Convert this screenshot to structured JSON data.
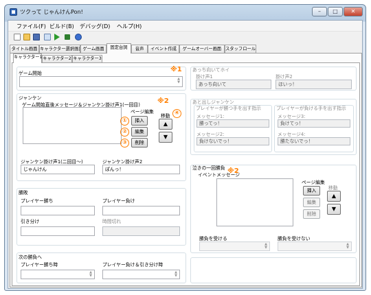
{
  "window": {
    "title": "ツクって じゃんけんPon!",
    "btn_min": "–",
    "btn_max": "□",
    "btn_close": "✕"
  },
  "menu": [
    "ファイル(F)",
    "ビルド(B)",
    "デバッグ(D)",
    "ヘルプ(H)"
  ],
  "toolbar_icons": [
    "new-document-icon",
    "open-folder-icon",
    "save-disk-icon",
    "copy-pages-icon",
    "play-icon",
    "stop-icon",
    "help-icon"
  ],
  "top_tabs": [
    "タイトル画面",
    "キャラクター選択画面",
    "ゲーム画面",
    "固定台詞",
    "音声",
    "イベント作成",
    "ゲームオーバー画面",
    "スタッフロール"
  ],
  "char_tabs": [
    "キャラクター1",
    "キャラクター2",
    "キャラクター3"
  ],
  "annotations": {
    "note1": "※1",
    "note2a": "※2",
    "note2b": "※2",
    "c1": "①",
    "c2": "②",
    "c3": "③",
    "c4": "④"
  },
  "left": {
    "game_start": "ゲーム開始",
    "janken": "ジャンケン",
    "janken_msg": "ゲーム開始直後メッセージ＆ジャンケン掛け声1(一回目)",
    "page_edit": "ページ編集",
    "move": "移動",
    "insert": "挿入",
    "edit": "編集",
    "delete": "削除",
    "up": "▲",
    "down": "▼",
    "kakegoe1_label": "ジャンケン掛け声1(二回目〜)",
    "kakegoe1_value": "じゃんけん",
    "kakegoe2_label": "ジャンケン掛け声2",
    "kakegoe2_value": "ぽんっ！",
    "shohai": "勝敗",
    "player_win": "プレイヤー勝ち",
    "player_lose": "プレイヤー負け",
    "draw": "引き分け",
    "timeout": "時間切れ",
    "next_game": "次の勝負へ",
    "next_win": "プレイヤー勝ち時",
    "next_lose_draw": "プレイヤー負け＆引き分け時"
  },
  "right": {
    "acchi": "あっち向いてホイ",
    "kake1": "掛け声1",
    "kake1_value": "あっち向いて",
    "kake2": "掛け声2",
    "kake2_value": "ほいっ！",
    "atodashi": "あと出しジャンケン",
    "p_win_hand": "プレイヤーが勝つ手を出す指示",
    "p_lose_hand": "プレイヤーが負ける手を出す指示",
    "msg1": "メッセージ1:",
    "msg1_value": "勝ってっ！",
    "msg2": "メッセージ2:",
    "msg2_value": "負けないでっ！",
    "msg3": "メッセージ3:",
    "msg3_value": "負けてっ！",
    "msg4": "メッセージ4:",
    "msg4_value": "勝たないでっ！",
    "nakinoichi": "泣きの一回勝負",
    "event_msg": "イベントメッセージ",
    "page_edit": "ページ編集",
    "move": "移動",
    "insert": "挿入",
    "edit": "編集",
    "delete": "削除",
    "up": "▲",
    "down": "▼",
    "accept": "勝負を受ける",
    "decline": "勝負を受けない"
  }
}
